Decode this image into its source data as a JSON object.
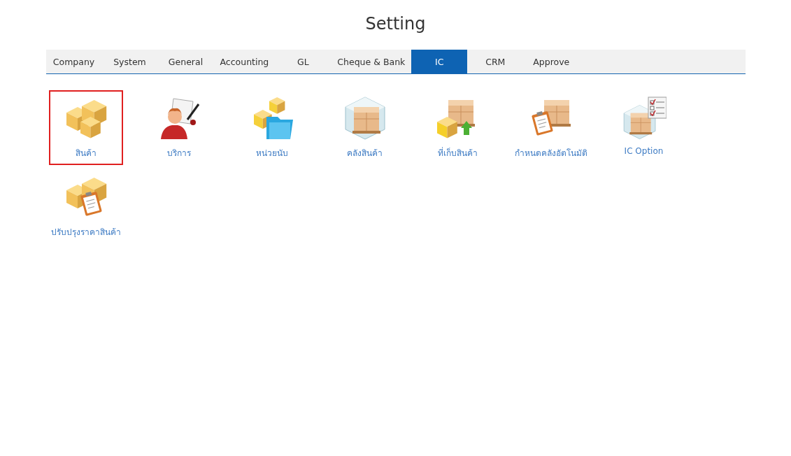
{
  "title": "Setting",
  "tabs": [
    {
      "label": "Company",
      "selected": false
    },
    {
      "label": "System",
      "selected": false
    },
    {
      "label": "General",
      "selected": false
    },
    {
      "label": "Accounting",
      "selected": false
    },
    {
      "label": "GL",
      "selected": false
    },
    {
      "label": "Cheque & Bank",
      "selected": false
    },
    {
      "label": "IC",
      "selected": true
    },
    {
      "label": "CRM",
      "selected": false
    },
    {
      "label": "Approve",
      "selected": false
    }
  ],
  "items": [
    {
      "label": "สินค้า",
      "kind": "boxes",
      "selected": true
    },
    {
      "label": "บริการ",
      "kind": "person",
      "selected": false
    },
    {
      "label": "หน่วยนับ",
      "kind": "folder",
      "selected": false
    },
    {
      "label": "คลังสินค้า",
      "kind": "warehouse",
      "selected": false
    },
    {
      "label": "ที่เก็บสินค้า",
      "kind": "pallet",
      "selected": false
    },
    {
      "label": "กำหนดคลังอัตโนมัติ",
      "kind": "clipboard",
      "selected": false
    },
    {
      "label": "IC Option",
      "kind": "checklist",
      "selected": false
    },
    {
      "label": "ปรับปรุงราคาสินค้า",
      "kind": "price",
      "selected": false
    }
  ]
}
